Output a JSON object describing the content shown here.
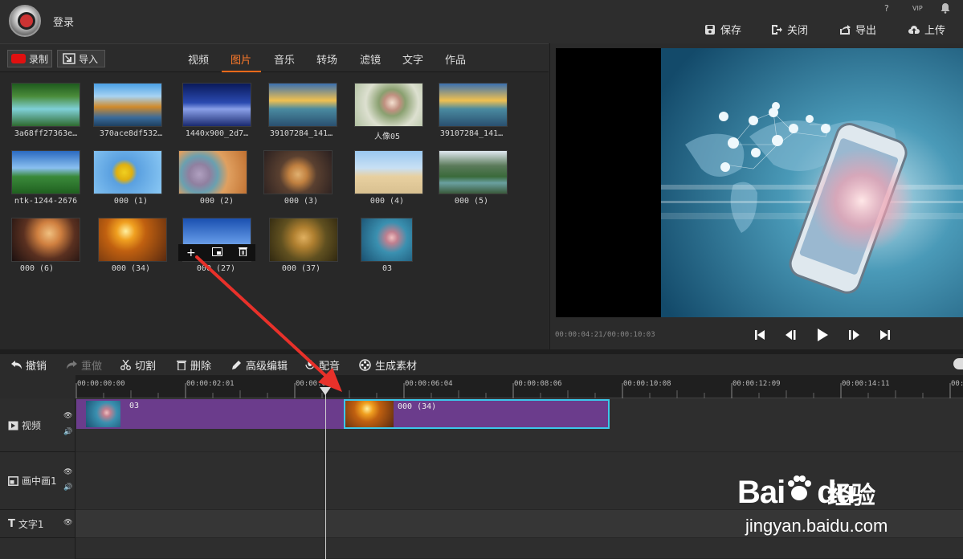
{
  "header": {
    "login": "登录",
    "help": "?",
    "vip": "VIP",
    "buttons": {
      "save": "保存",
      "close": "关闭",
      "export": "导出",
      "upload": "上传"
    }
  },
  "library": {
    "record": "录制",
    "import": "导入",
    "tabs": [
      "视频",
      "图片",
      "音乐",
      "转场",
      "滤镜",
      "文字",
      "作品"
    ],
    "active_tab": "图片",
    "items": [
      {
        "label": "3a68ff27363e…"
      },
      {
        "label": "370ace8df532…"
      },
      {
        "label": "1440x900_2d7…"
      },
      {
        "label": "39107284_141…"
      },
      {
        "label": "人像05"
      },
      {
        "label": "39107284_141…"
      },
      {
        "label": "ntk-1244-2676"
      },
      {
        "label": "000 (1)"
      },
      {
        "label": "000 (2)"
      },
      {
        "label": "000 (3)"
      },
      {
        "label": "000 (4)"
      },
      {
        "label": "000 (5)"
      },
      {
        "label": "000 (6)"
      },
      {
        "label": "000 (34)"
      },
      {
        "label": "000 (27)"
      },
      {
        "label": "000 (37)"
      },
      {
        "label": "03"
      }
    ],
    "hover_actions": [
      "+",
      "⧉",
      "🗑"
    ]
  },
  "preview": {
    "timecode": "00:00:04:21/00:00:10:03"
  },
  "edit_toolbar": {
    "undo": "撤销",
    "redo": "重做",
    "cut": "切割",
    "delete": "删除",
    "advanced": "高级编辑",
    "dub": "配音",
    "generate": "生成素材"
  },
  "timeline": {
    "ruler": [
      "00:00:00:00",
      "00:00:02:01",
      "00:00:0…",
      "00:00:06:04",
      "00:00:08:06",
      "00:00:10:08",
      "00:00:12:09",
      "00:00:14:11",
      "00:00:1…"
    ],
    "tracks": {
      "video": "视频",
      "pip": "画中画1",
      "text": "文字1"
    },
    "clips": [
      {
        "label": "03"
      },
      {
        "label": "000 (34)"
      }
    ]
  },
  "watermark": {
    "bai": "Bai",
    "du": "du",
    "cn": "经验",
    "url": "jingyan.baidu.com"
  }
}
